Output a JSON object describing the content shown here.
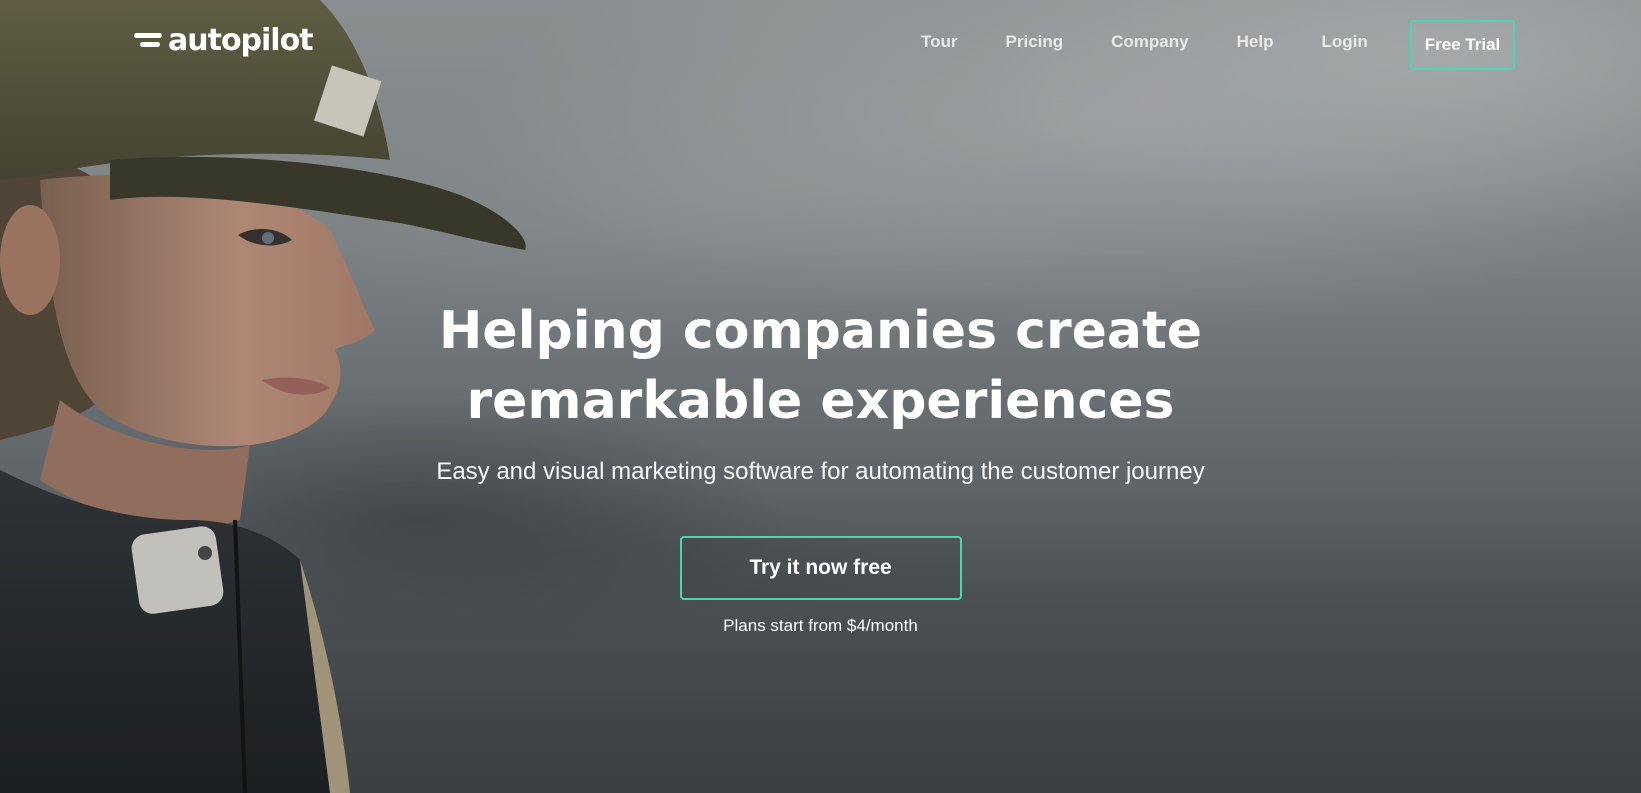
{
  "brand": {
    "name": "autopilot"
  },
  "nav": {
    "links": [
      "Tour",
      "Pricing",
      "Company",
      "Help",
      "Login"
    ],
    "cta_label": "Free Trial"
  },
  "hero": {
    "headline_line1": "Helping companies create",
    "headline_line2": "remarkable experiences",
    "subheadline": "Easy and visual marketing software for automating the customer journey",
    "cta_label": "Try it now free",
    "pricing_note": "Plans start from $4/month"
  },
  "colors": {
    "accent": "#4dd5b3",
    "text": "#ffffff"
  }
}
